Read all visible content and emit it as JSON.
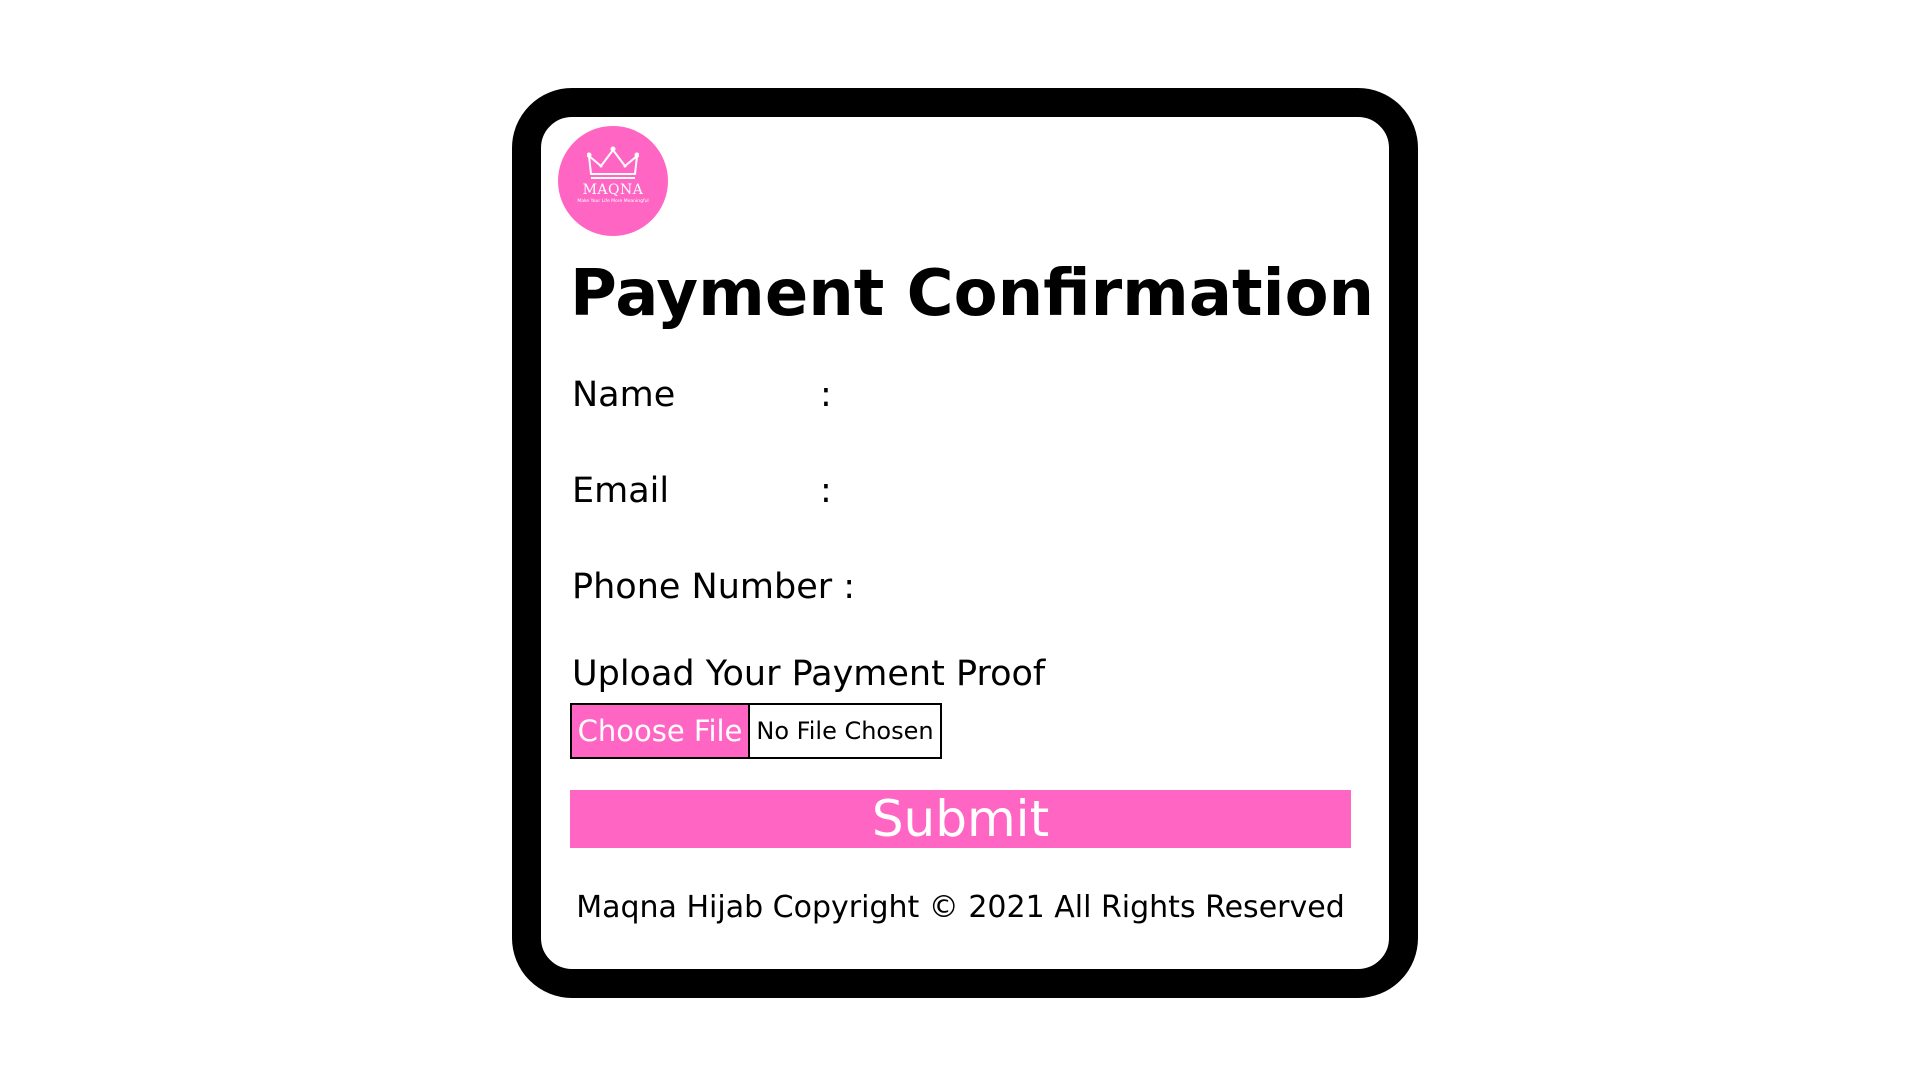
{
  "logo": {
    "icon": "crown-icon",
    "name": "MAQNA",
    "tagline": "Make Your Life More Meaningful"
  },
  "title": "Payment Confirmation",
  "fields": [
    {
      "label": "Name",
      "colon": ":"
    },
    {
      "label": "Email",
      "colon": ":"
    },
    {
      "label": "Phone Number :"
    }
  ],
  "upload": {
    "label": "Upload Your Payment Proof",
    "button_label": "Choose File",
    "status": "No File Chosen"
  },
  "submit_label": "Submit",
  "footer": "Maqna Hijab Copyright © 2021 All Rights Reserved",
  "colors": {
    "accent": "#ff66c4",
    "frame": "#000000",
    "background": "#ffffff"
  }
}
